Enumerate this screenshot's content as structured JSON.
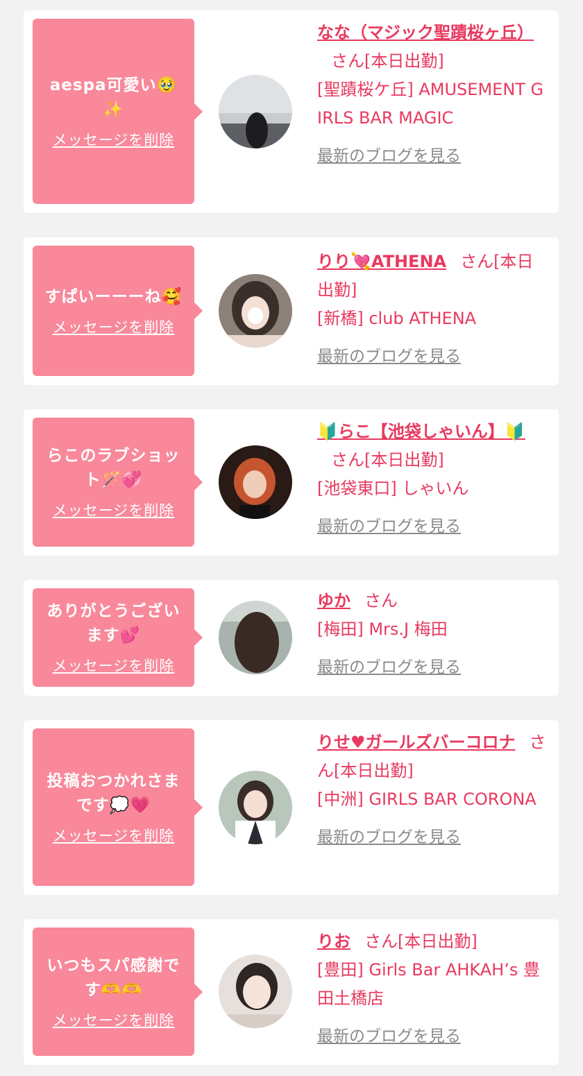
{
  "delete_label": "メッセージを削除",
  "blog_label": "最新のブログを見る",
  "san_label": "さん",
  "colors": {
    "bubble": "#f8889a",
    "accent": "#e8395f",
    "link_gray": "#8a8a8a",
    "background": "#f2f2f2"
  },
  "items": [
    {
      "message": "aespa可愛い🥹✨",
      "name": "なな（マジック聖蹟桜ヶ丘）",
      "status": "[本日出勤]",
      "shop": "[聖蹟桜ケ丘] AMUSEMENT GIRLS BAR MAGIC"
    },
    {
      "message": "すぱいーーーね🥰",
      "name": "りり💘ATHENA",
      "status": "[本日出勤]",
      "shop": "[新橋] club ATHENA"
    },
    {
      "message": "らこのラブショット🪄💞",
      "name": "🔰らこ【池袋しゃいん】🔰",
      "status": "[本日出勤]",
      "shop": "[池袋東口] しゃいん"
    },
    {
      "message": "ありがとうございます💕",
      "name": "ゆか",
      "status": "",
      "shop": "[梅田] Mrs.J 梅田"
    },
    {
      "message": "投稿おつかれさまです💭💗",
      "name": "りせ♥ガールズバーコロナ",
      "status": "[本日出勤]",
      "shop": "[中洲] GIRLS BAR CORONA"
    },
    {
      "message": "いつもスパ感謝です🫶🫶",
      "name": "りお",
      "status": "[本日出勤]",
      "shop": "[豊田] Girls Bar AHKAH’s 豊田土橋店"
    }
  ]
}
